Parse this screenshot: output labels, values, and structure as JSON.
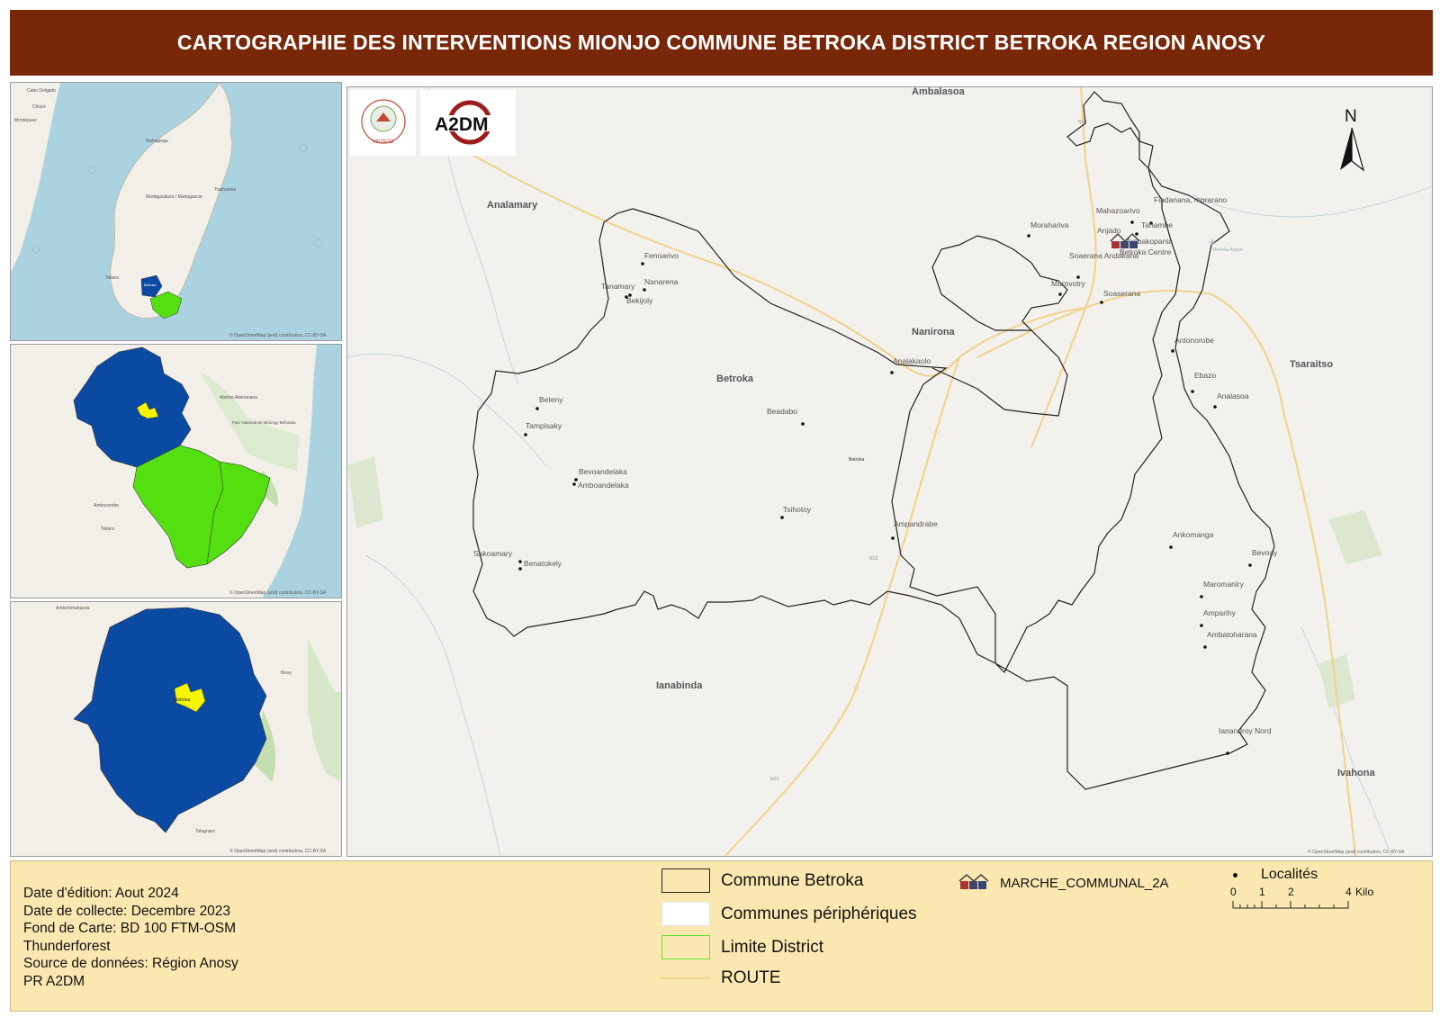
{
  "title": "CARTOGRAPHIE DES INTERVENTIONS MIONJO COMMUNE BETROKA DISTRICT BETROKA REGION ANOSY",
  "colors": {
    "title_bg": "#782709",
    "legend_bg": "#fbe8b1",
    "district_fill": "#0b4aa2",
    "region_fill": "#54e010",
    "commune_fill": "#f5f500",
    "sea": "#aad3df",
    "route": "#f2d288"
  },
  "insets": {
    "madagascar": {
      "labels": [
        "Cabo Delgado",
        "Chiuré",
        "Montepuez",
        "Mahajanga",
        "Madagasikara / Madagascar",
        "Toamasina",
        "Toliara"
      ],
      "marker_label": "Betroka"
    },
    "region": {
      "labels": [
        "Atsimo-Atsinanana",
        "Parc National de Midongy Befotaka",
        "Toliara",
        "Ambovombe"
      ]
    },
    "district": {
      "labels": [
        "Ambohimahasoa",
        "Ihosy",
        "Tolagnaro"
      ],
      "marker_label": "Betroka"
    },
    "attribution": "© OpenStreetMap (and) contributors, CC-BY-SA"
  },
  "logos": {
    "mionjo": "MIONJO",
    "a2dm": "A2DM"
  },
  "north_arrow": "N",
  "neighbour_communes": [
    "Ambalasoa",
    "Analamary",
    "Nanirona",
    "Tsaraitso",
    "Betroka",
    "Ianabinda",
    "Ivahona"
  ],
  "localities": [
    "Fenoarivo",
    "Tanamary",
    "Nanarena",
    "Bekijoly",
    "Beteny",
    "Tampisaky",
    "Bevoandelaka",
    "Amboandelaka",
    "Sakoamary",
    "Benatokely",
    "Beadabo",
    "Tsihotoy",
    "Analakaolo",
    "Ampandrabe",
    "Morahariva",
    "Mahazoarivo",
    "Fiadanana, morarano",
    "Tanambe",
    "Anjado",
    "Ambakopania",
    "Betroka Centre",
    "Soaerana Andakana",
    "Marovotry",
    "Soaserana",
    "Antonorobe",
    "Ebazo",
    "Analasoa",
    "Ankomanga",
    "Bevoay",
    "Maromaniry",
    "Amparihy",
    "Ambatoharana",
    "Ianandroy Nord"
  ],
  "map_text": {
    "town_label": "Betroka",
    "airport": "Betroka Airport",
    "road_labels": [
      "N13",
      "N13",
      "N13"
    ],
    "attribution": "© OpenStreetMap (and) contributors, CC-BY-SA"
  },
  "info": {
    "edition": "Date d'édition: Aout 2024",
    "collecte": "Date de collecte: Decembre 2023",
    "fond": "Fond de Carte: BD 100 FTM-OSM",
    "fond2": "Thunderforest",
    "source": "Source de données: Région Anosy",
    "pr": "PR A2DM"
  },
  "legend": {
    "commune": "Commune Betroka",
    "peripheriques": "Communes périphériques",
    "district": "Limite District",
    "route": "ROUTE",
    "marche": "MARCHE_COMMUNAL_2A",
    "localites": "Localités"
  },
  "scale_bar": {
    "ticks": [
      "0",
      "1",
      "2",
      "4"
    ],
    "unit": "Kilometers"
  }
}
